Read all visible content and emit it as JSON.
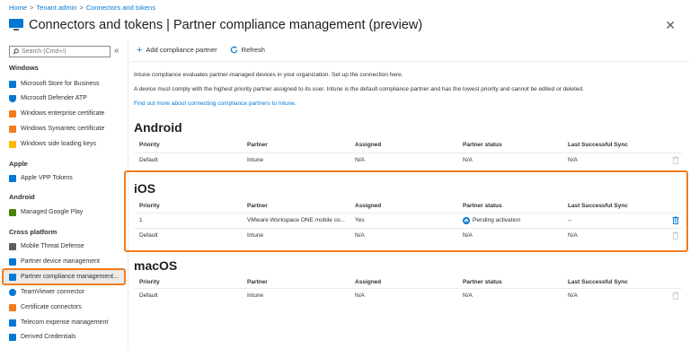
{
  "breadcrumb": [
    "Home",
    "Tenant admin",
    "Connectors and tokens"
  ],
  "header": {
    "title": "Connectors and tokens | Partner compliance management (preview)",
    "close": "✕"
  },
  "sidebar": {
    "search_placeholder": "Search (Cmd+/)",
    "collapse": "«",
    "sections": {
      "windows": "Windows",
      "apple": "Apple",
      "android": "Android",
      "cross": "Cross platform"
    },
    "items": {
      "store": "Microsoft Store for Business",
      "defender": "Microsoft Defender ATP",
      "win_cert": "Windows enterprise certificate",
      "symantec": "Windows Symantec certificate",
      "sideload": "Windows side loading keys",
      "vpp": "Apple VPP Tokens",
      "gplay": "Managed Google Play",
      "mtd": "Mobile Threat Defense",
      "pdm": "Partner device management",
      "pcm": "Partner compliance management...",
      "teamviewer": "TeamViewer connector",
      "certconn": "Certificate connectors",
      "telecom": "Telecom expense management",
      "derived": "Derived Credentials"
    },
    "colors": {
      "blue": "#0078d4",
      "orange": "#f27c1e",
      "green": "#498205",
      "yellow": "#ffb900"
    }
  },
  "toolbar": {
    "add": "Add compliance partner",
    "refresh": "Refresh"
  },
  "desc": {
    "line1": "Intune compliance evaluates partner-managed devices in your organization. Set up the connection here.",
    "line2": "A device must comply with the highest priority partner assigned to its user. Intune is the default compliance partner and has the lowest priority and cannot be edited or deleted.",
    "link": "Find out more about connecting compliance partners to Intune."
  },
  "columns": {
    "priority": "Priority",
    "partner": "Partner",
    "assigned": "Assigned",
    "status": "Partner status",
    "sync": "Last Successful Sync"
  },
  "android": {
    "title": "Android",
    "rows": [
      {
        "priority": "Default",
        "partner": "Intune",
        "assigned": "N/A",
        "status": "N/A",
        "sync": "N/A"
      }
    ]
  },
  "ios": {
    "title": "iOS",
    "rows": [
      {
        "priority": "1",
        "partner": "VMware Workspace ONE mobile co...",
        "assigned": "Yes",
        "status": "Pending activation",
        "sync": "--"
      },
      {
        "priority": "Default",
        "partner": "Intune",
        "assigned": "N/A",
        "status": "N/A",
        "sync": "N/A"
      }
    ]
  },
  "macos": {
    "title": "macOS",
    "rows": [
      {
        "priority": "Default",
        "partner": "Intune",
        "assigned": "N/A",
        "status": "N/A",
        "sync": "N/A"
      }
    ]
  }
}
